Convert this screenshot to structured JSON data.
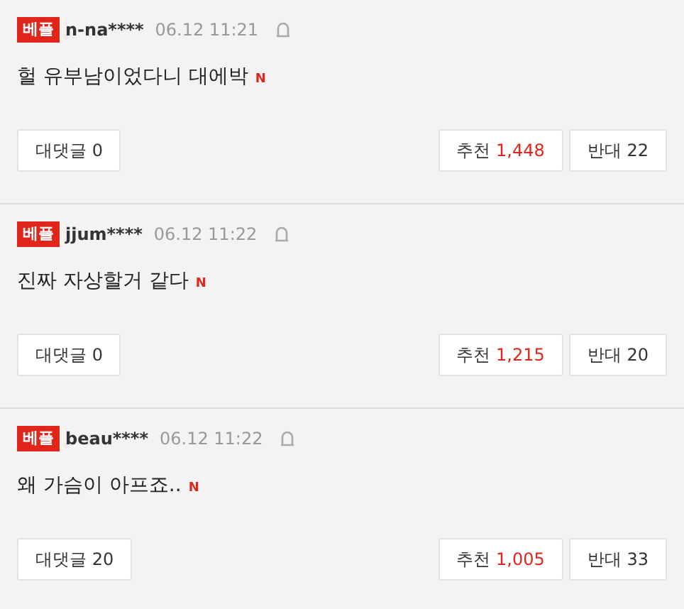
{
  "comments": [
    {
      "badge": "베플",
      "user": "n-na****",
      "time": "06.12 11:21",
      "text": "헐 유부남이었다니 대에박",
      "new_mark": "N",
      "reply_label": "대댓글",
      "reply_count": "0",
      "like_label": "추천",
      "like_count": "1,448",
      "dislike_label": "반대",
      "dislike_count": "22"
    },
    {
      "badge": "베플",
      "user": "jjum****",
      "time": "06.12 11:22",
      "text": "진짜 자상할거 같다",
      "new_mark": "N",
      "reply_label": "대댓글",
      "reply_count": "0",
      "like_label": "추천",
      "like_count": "1,215",
      "dislike_label": "반대",
      "dislike_count": "20"
    },
    {
      "badge": "베플",
      "user": "beau****",
      "time": "06.12 11:22",
      "text": "왜 가슴이 아프죠..",
      "new_mark": "N",
      "reply_label": "대댓글",
      "reply_count": "20",
      "like_label": "추천",
      "like_count": "1,005",
      "dislike_label": "반대",
      "dislike_count": "33"
    }
  ]
}
